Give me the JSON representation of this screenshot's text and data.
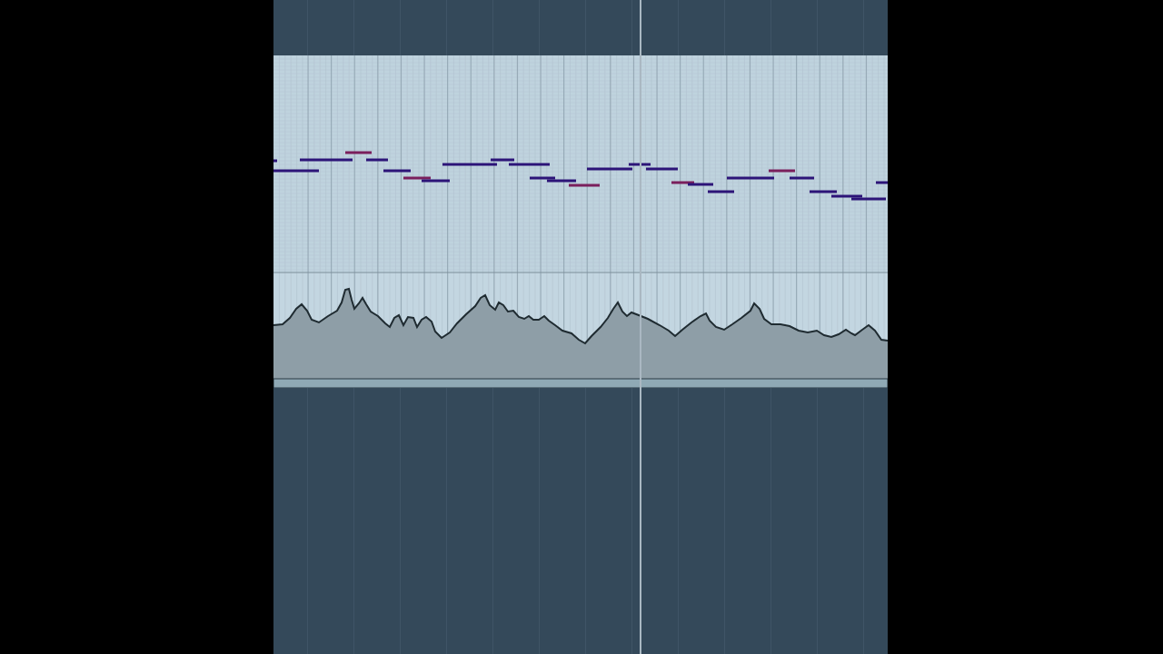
{
  "piano_roll": {
    "notes": [
      {
        "selected": false
      },
      {
        "selected": false
      },
      {
        "selected": false
      },
      {
        "selected": true
      },
      {
        "selected": false
      },
      {
        "selected": false
      },
      {
        "selected": true
      },
      {
        "selected": false
      },
      {
        "selected": false
      },
      {
        "selected": false
      },
      {
        "selected": false
      },
      {
        "selected": false
      },
      {
        "selected": false
      },
      {
        "selected": true
      },
      {
        "selected": false
      },
      {
        "selected": false
      },
      {
        "selected": false
      },
      {
        "selected": true
      },
      {
        "selected": false
      },
      {
        "selected": false
      },
      {
        "selected": false
      },
      {
        "selected": true
      },
      {
        "selected": false
      },
      {
        "selected": false
      },
      {
        "selected": false
      },
      {
        "selected": false
      },
      {
        "selected": false
      }
    ]
  }
}
